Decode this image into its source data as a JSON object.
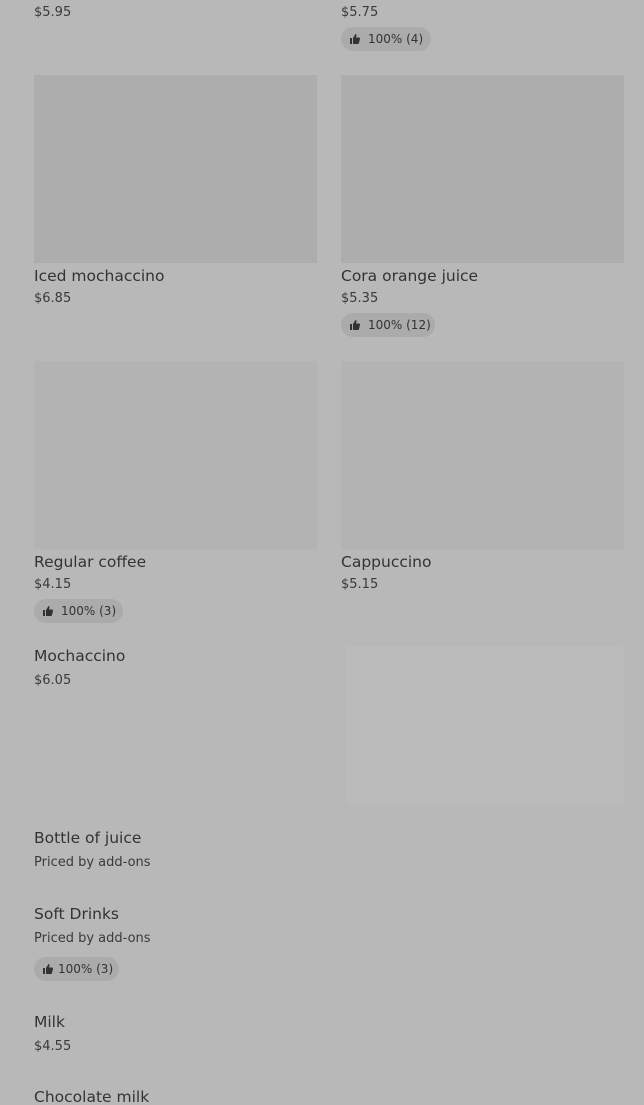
{
  "menu": {
    "row0": {
      "left": {
        "price": "$5.95"
      },
      "right": {
        "price": "$5.75",
        "rating": "100% (4)"
      }
    },
    "iced_mochaccino": {
      "name": "Iced mochaccino",
      "price": "$6.85"
    },
    "cora_orange_juice": {
      "name": "Cora orange juice",
      "price": "$5.35",
      "rating": "100% (12)"
    },
    "regular_coffee": {
      "name": "Regular coffee",
      "price": "$4.15",
      "rating": "100% (3)"
    },
    "cappuccino": {
      "name": "Cappuccino",
      "price": "$5.15"
    },
    "mochaccino": {
      "name": "Mochaccino",
      "price": "$6.05"
    },
    "bottle_of_juice": {
      "name": "Bottle of juice",
      "price": "Priced by add-ons"
    },
    "soft_drinks": {
      "name": "Soft Drinks",
      "price": "Priced by add-ons",
      "rating": "100% (3)"
    },
    "milk": {
      "name": "Milk",
      "price": "$4.55"
    },
    "chocolate_milk": {
      "name": "Chocolate milk"
    }
  },
  "icons": {
    "rating": "thumbs-up-icon"
  },
  "colors": {
    "overlay_background": "#b8b8b8",
    "image_placeholder": "#adadad",
    "badge_background": "#ababab",
    "text": "#333333"
  }
}
